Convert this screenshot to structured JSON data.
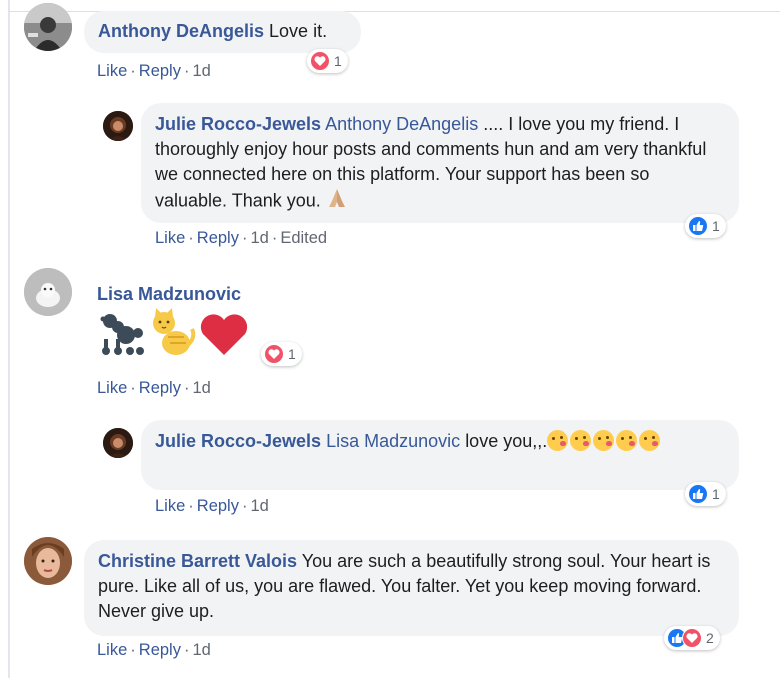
{
  "comments": [
    {
      "author": "Anthony DeAngelis",
      "text": "Love it.",
      "actions": {
        "like": "Like",
        "reply": "Reply",
        "time": "1d"
      },
      "reactions": {
        "types": [
          "love"
        ],
        "count": "1"
      }
    },
    {
      "author": "Julie Rocco-Jewels",
      "mention": "Anthony DeAngelis",
      "text": ".... I love you my friend. I thoroughly enjoy hour posts and comments hun and am very thankful we connected here on this platform. Your support has been so valuable. Thank you.",
      "emoji": "folded-hands-emoji",
      "actions": {
        "like": "Like",
        "reply": "Reply",
        "time": "1d",
        "edited": "Edited"
      },
      "reactions": {
        "types": [
          "like"
        ],
        "count": "1"
      }
    },
    {
      "author": "Lisa Madzunovic",
      "text": "",
      "emoji": [
        "poodle-emoji",
        "cat-emoji",
        "heart-emoji"
      ],
      "actions": {
        "like": "Like",
        "reply": "Reply",
        "time": "1d"
      },
      "reactions": {
        "types": [
          "love"
        ],
        "count": "1"
      }
    },
    {
      "author": "Julie Rocco-Jewels",
      "mention": "Lisa Madzunovic",
      "text": "love you,,.",
      "emoji": [
        "kissing-face-emoji",
        "kissing-face-emoji",
        "kissing-face-emoji",
        "kissing-face-emoji",
        "kissing-face-emoji"
      ],
      "actions": {
        "like": "Like",
        "reply": "Reply",
        "time": "1d"
      },
      "reactions": {
        "types": [
          "like"
        ],
        "count": "1"
      }
    },
    {
      "author": "Christine Barrett Valois",
      "text": "You are such a beautifully strong soul. Your heart is pure. Like all of us, you are flawed. You falter. Yet you keep moving forward. Never give up.",
      "actions": {
        "like": "Like",
        "reply": "Reply",
        "time": "1d"
      },
      "reactions": {
        "types": [
          "like",
          "love"
        ],
        "count": "2"
      }
    }
  ],
  "colors": {
    "name_link": "#385898",
    "bubble_bg": "#f2f3f5",
    "like_blue": "#1877f2",
    "love_red": "#f25268",
    "meta_gray": "#606770"
  }
}
